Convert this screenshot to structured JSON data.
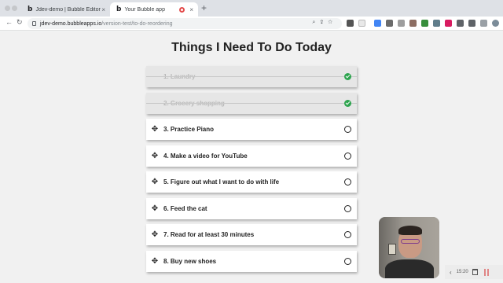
{
  "browser": {
    "tabs": [
      {
        "favicon": "b",
        "title": "Jdev-demo | Bubble Editor",
        "close": "×"
      },
      {
        "favicon": "b",
        "title": "Your Bubble app",
        "close": "×"
      }
    ],
    "new_tab": "+",
    "back": "←",
    "reload": "↻",
    "url_host": "jdev-demo.bubbleapps.io",
    "url_path": "/version-test/to-do-reordering"
  },
  "page": {
    "title": "Things I Need To Do Today",
    "items": [
      {
        "label": "1. Laundry",
        "done": true
      },
      {
        "label": "2. Grocery shopping",
        "done": true
      },
      {
        "label": "3. Practice Piano",
        "done": false
      },
      {
        "label": "4. Make a video for YouTube",
        "done": false
      },
      {
        "label": "5. Figure out what I want to do with life",
        "done": false
      },
      {
        "label": "6. Feed the cat",
        "done": false
      },
      {
        "label": "7. Read for at least 30 minutes",
        "done": false
      },
      {
        "label": "8. Buy new shoes",
        "done": false
      }
    ],
    "handle_glyph": "✥"
  },
  "recorder": {
    "back": "‹",
    "time": "15:20"
  },
  "colors": {
    "check_done": "#2ea44f",
    "record_red": "#e34b4b"
  }
}
